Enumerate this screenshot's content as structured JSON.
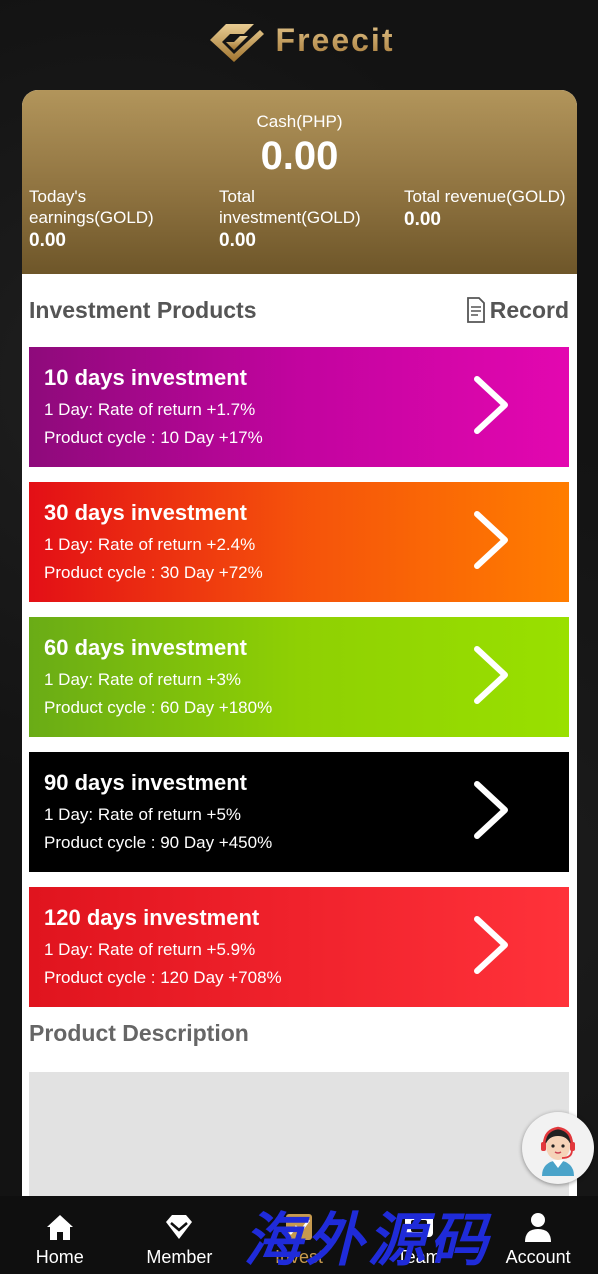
{
  "brand": {
    "name": "Freecit",
    "color": "#c9a05a"
  },
  "balance": {
    "cash_label": "Cash(PHP)",
    "cash_value": "0.00",
    "stats": [
      {
        "label": "Today's earnings(GOLD)",
        "value": "0.00"
      },
      {
        "label": "Total investment(GOLD)",
        "value": "0.00"
      },
      {
        "label": "Total revenue(GOLD)",
        "value": "0.00"
      }
    ]
  },
  "products_section": {
    "title": "Investment Products",
    "record_label": "Record"
  },
  "products": [
    {
      "title": "10 days investment",
      "rate": "1 Day: Rate of return +1.7%",
      "cycle": "Product cycle : 10 Day +17%",
      "color": "#c2049f"
    },
    {
      "title": "30 days investment",
      "rate": "1 Day: Rate of return +2.4%",
      "cycle": "Product cycle : 30 Day +72%",
      "color": "#f5520b"
    },
    {
      "title": "60 days investment",
      "rate": "1 Day: Rate of return +3%",
      "cycle": "Product cycle : 60 Day +180%",
      "color": "#8fd003"
    },
    {
      "title": "90 days investment",
      "rate": "1 Day: Rate of return +5%",
      "cycle": "Product cycle : 90 Day +450%",
      "color": "#000000"
    },
    {
      "title": "120 days investment",
      "rate": "1 Day: Rate of return +5.9%",
      "cycle": "Product cycle : 120 Day +708%",
      "color": "#f0222c"
    }
  ],
  "description": {
    "title": "Product Description"
  },
  "tabs": [
    {
      "label": "Home",
      "icon": "home-icon"
    },
    {
      "label": "Member",
      "icon": "diamond-icon"
    },
    {
      "label": "Invest",
      "icon": "chart-icon",
      "active": true
    },
    {
      "label": "Team",
      "icon": "team-icon"
    },
    {
      "label": "Account",
      "icon": "user-icon"
    }
  ],
  "watermark": "海外源码",
  "accent": "#c79a4e"
}
